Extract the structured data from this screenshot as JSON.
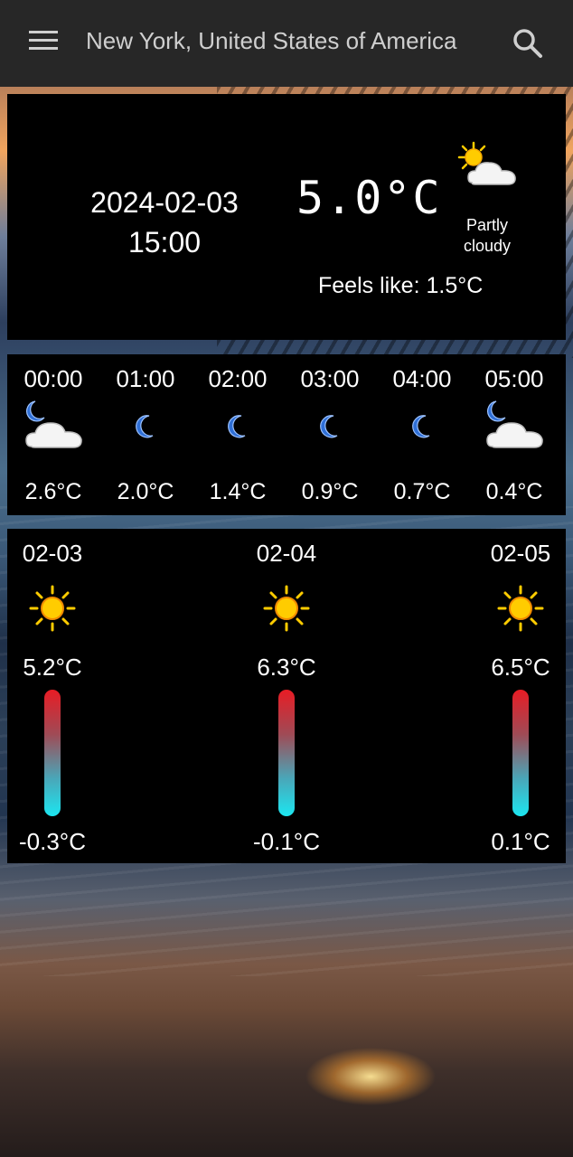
{
  "app_bar": {
    "title": "New York, United States of America",
    "menu_icon": "menu-icon",
    "search_icon": "search-icon"
  },
  "current": {
    "date": "2024-02-03",
    "time": "15:00",
    "temperature": "5.0°C",
    "condition_line1": "Partly",
    "condition_line2": "cloudy",
    "feels_like": "Feels like: 1.5°C",
    "icon": "partly-cloudy-day-icon"
  },
  "hourly": [
    {
      "time": "00:00",
      "temp": "2.6°C",
      "icon": "partly-cloudy-night-icon"
    },
    {
      "time": "01:00",
      "temp": "2.0°C",
      "icon": "moon-icon"
    },
    {
      "time": "02:00",
      "temp": "1.4°C",
      "icon": "moon-icon"
    },
    {
      "time": "03:00",
      "temp": "0.9°C",
      "icon": "moon-icon"
    },
    {
      "time": "04:00",
      "temp": "0.7°C",
      "icon": "moon-icon"
    },
    {
      "time": "05:00",
      "temp": "0.4°C",
      "icon": "partly-cloudy-night-icon"
    }
  ],
  "daily": [
    {
      "date": "02-03",
      "high": "5.2°C",
      "low": "-0.3°C",
      "icon": "sun-icon"
    },
    {
      "date": "02-04",
      "high": "6.3°C",
      "low": "-0.1°C",
      "icon": "sun-icon"
    },
    {
      "date": "02-05",
      "high": "6.5°C",
      "low": "0.1°C",
      "icon": "sun-icon"
    }
  ],
  "colors": {
    "app_bar": "#272727",
    "panel": "#000000",
    "bar_hot": "#e81c24",
    "bar_cold": "#1ce6f0",
    "sun": "#ffcc00",
    "moon": "#2f6fd6"
  }
}
